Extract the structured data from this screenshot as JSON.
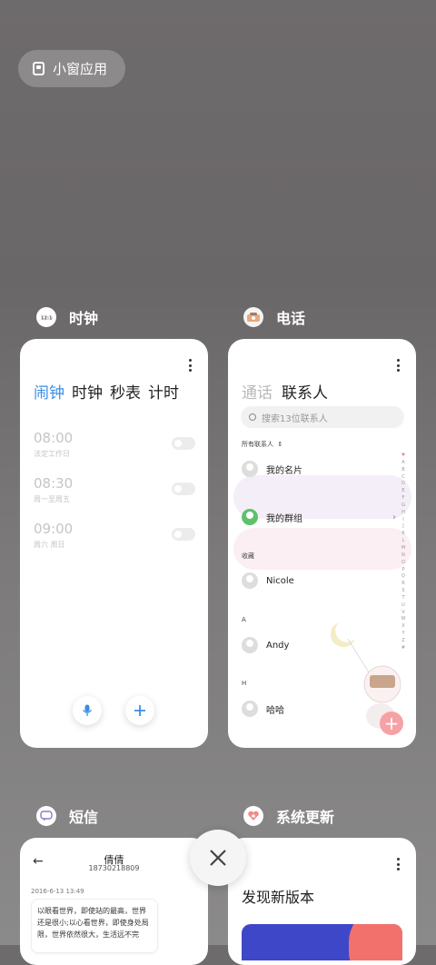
{
  "small_window": {
    "label": "小窗应用"
  },
  "apps": {
    "clock": {
      "name": "时钟",
      "icon": "clock-icon"
    },
    "phone": {
      "name": "电话",
      "icon": "phone-icon"
    },
    "sms": {
      "name": "短信",
      "icon": "message-icon"
    },
    "update": {
      "name": "系统更新",
      "icon": "update-icon"
    }
  },
  "clock": {
    "tabs": [
      "闹钟",
      "时钟",
      "秒表",
      "计时"
    ],
    "active_tab": "闹钟",
    "alarms": [
      {
        "time": "08:00",
        "repeat": "法定工作日",
        "enabled": false
      },
      {
        "time": "08:30",
        "repeat": "周一至周五",
        "enabled": false
      },
      {
        "time": "09:00",
        "repeat": "周六 周日",
        "enabled": false
      }
    ]
  },
  "phone": {
    "tabs": [
      "通话",
      "联系人"
    ],
    "active_tab": "联系人",
    "search_placeholder": "搜索13位联系人",
    "all_contacts": "所有联系人",
    "my_card": "我的名片",
    "my_groups": "我的群组",
    "favorites_header": "收藏",
    "contacts": [
      {
        "section": "",
        "name": "Nicole"
      },
      {
        "section": "A",
        "name": "Andy"
      },
      {
        "section": "H",
        "name": "哈哈"
      }
    ],
    "index_letters": [
      "A",
      "B",
      "C",
      "D",
      "E",
      "F",
      "G",
      "H",
      "I",
      "J",
      "K",
      "L",
      "M",
      "N",
      "O",
      "P",
      "Q",
      "R",
      "S",
      "T",
      "U",
      "V",
      "W",
      "X",
      "Y",
      "Z",
      "#"
    ]
  },
  "sms": {
    "contact_name": "倩倩",
    "contact_number": "18730218809",
    "date": "2016-6-13 13:49",
    "message": "以眼看世界，即使站的最高，世界还是很小;以心看世界，即使身处局限，世界依然很大，生活远不完"
  },
  "update": {
    "title": "发现新版本",
    "banner_colors": [
      "#3f47c9",
      "#f2716c"
    ]
  },
  "colors": {
    "accent": "#3a8ee6",
    "fab": "#f6a1a4"
  }
}
